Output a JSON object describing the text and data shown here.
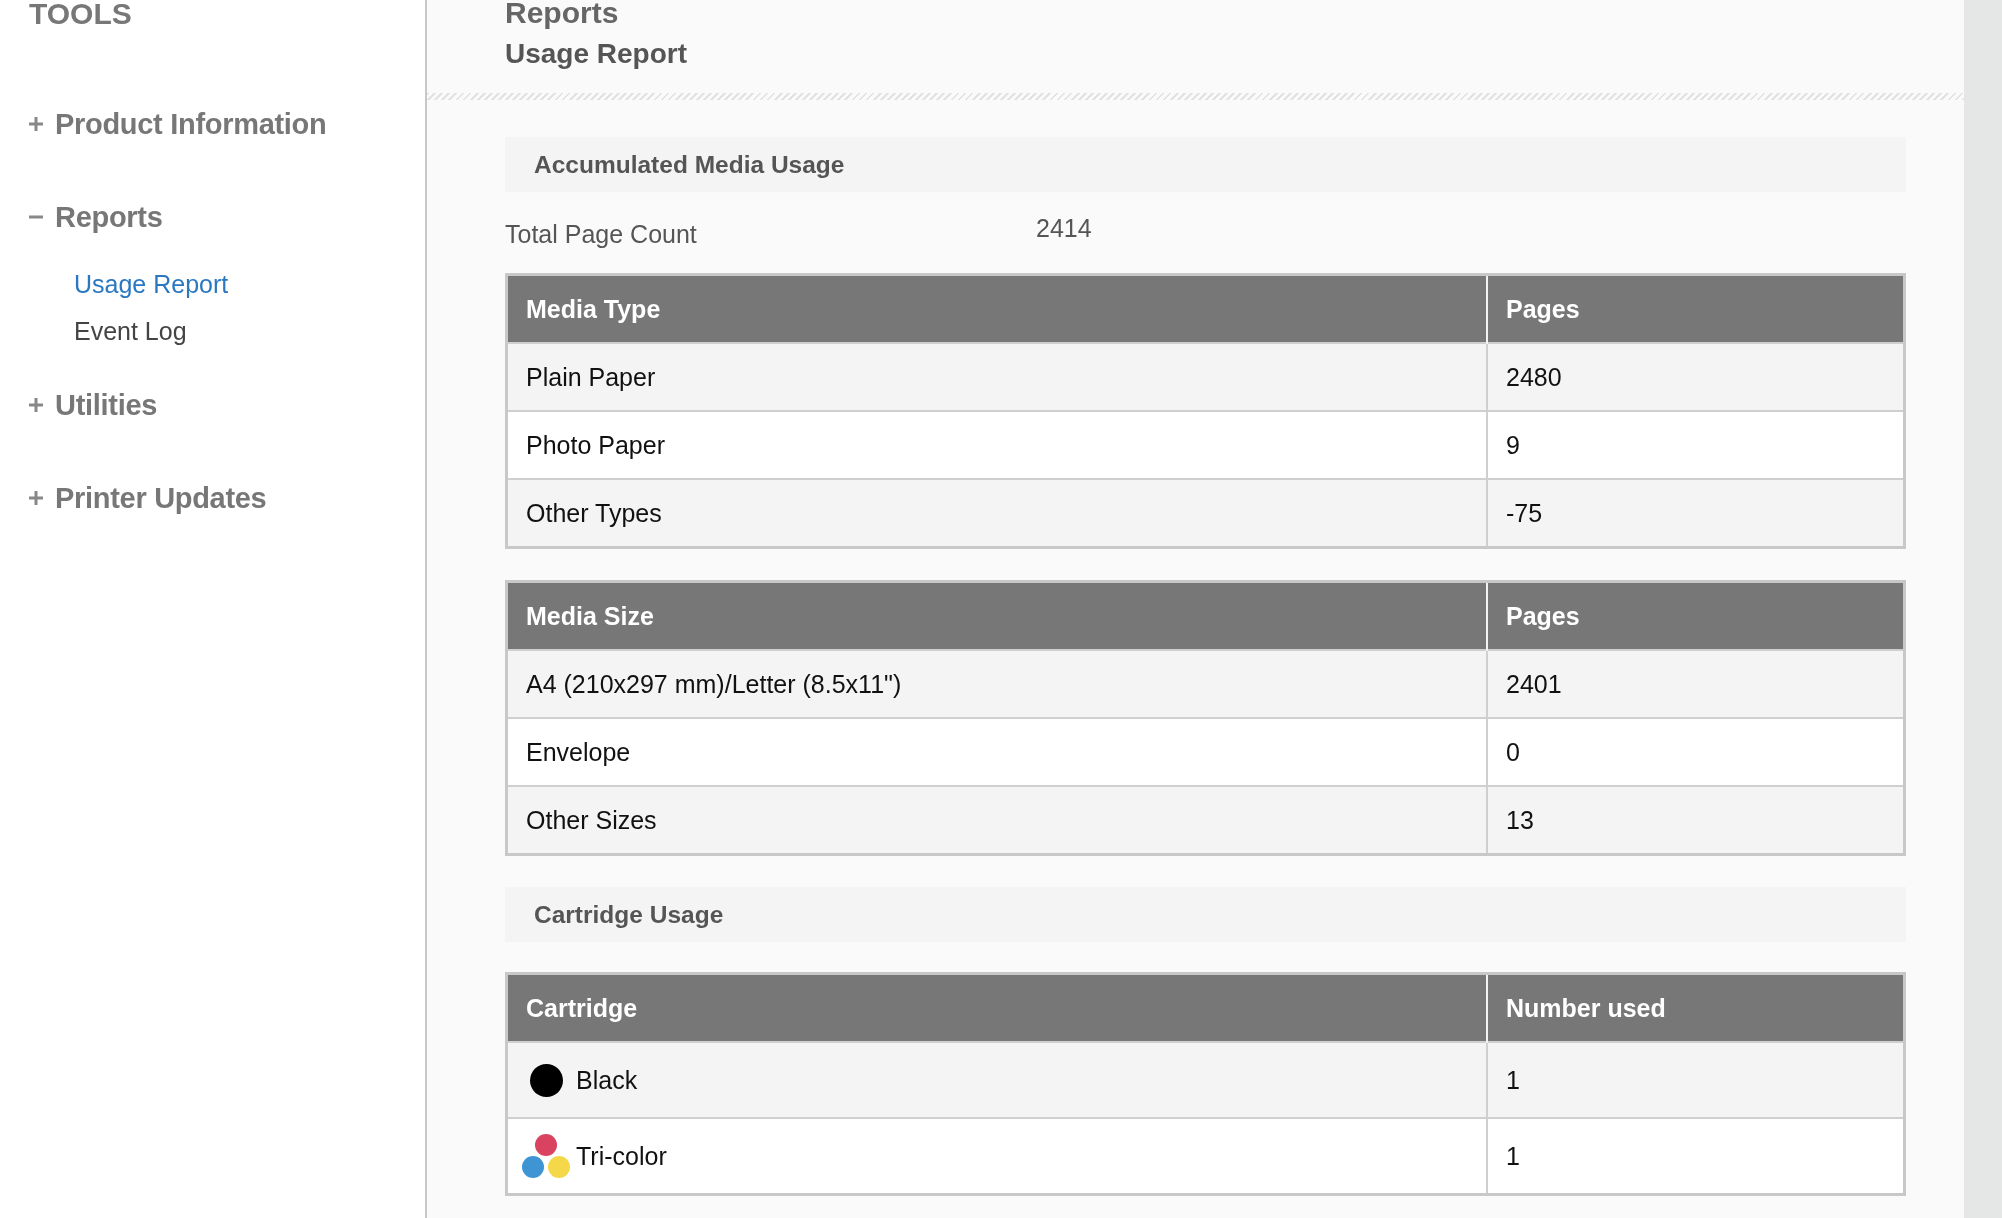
{
  "sidebar": {
    "title": "TOOLS",
    "sections": [
      {
        "label": "Product Information",
        "expanded": false
      },
      {
        "label": "Reports",
        "expanded": true,
        "children": [
          {
            "label": "Usage Report",
            "selected": true
          },
          {
            "label": "Event Log",
            "selected": false
          }
        ]
      },
      {
        "label": "Utilities",
        "expanded": false
      },
      {
        "label": "Printer Updates",
        "expanded": false
      }
    ]
  },
  "main": {
    "title": "Reports",
    "subtitle": "Usage Report"
  },
  "media_usage": {
    "heading": "Accumulated Media Usage",
    "total": {
      "label": "Total Page Count",
      "value": "2414"
    },
    "tables": [
      {
        "columns": [
          "Media Type",
          "Pages"
        ],
        "rows": [
          [
            "Plain Paper",
            "2480"
          ],
          [
            "Photo Paper",
            "9"
          ],
          [
            "Other Types",
            "-75"
          ]
        ]
      },
      {
        "columns": [
          "Media Size",
          "Pages"
        ],
        "rows": [
          [
            "A4 (210x297 mm)/Letter (8.5x11\")",
            "2401"
          ],
          [
            "Envelope",
            "0"
          ],
          [
            "Other Sizes",
            "13"
          ]
        ]
      }
    ]
  },
  "cartridge_usage": {
    "heading": "Cartridge Usage",
    "columns": [
      "Cartridge",
      "Number used"
    ],
    "rows": [
      {
        "kind": "black",
        "name": "Black",
        "count": "1"
      },
      {
        "kind": "tricolor",
        "name": "Tri-color",
        "count": "1"
      }
    ]
  }
}
